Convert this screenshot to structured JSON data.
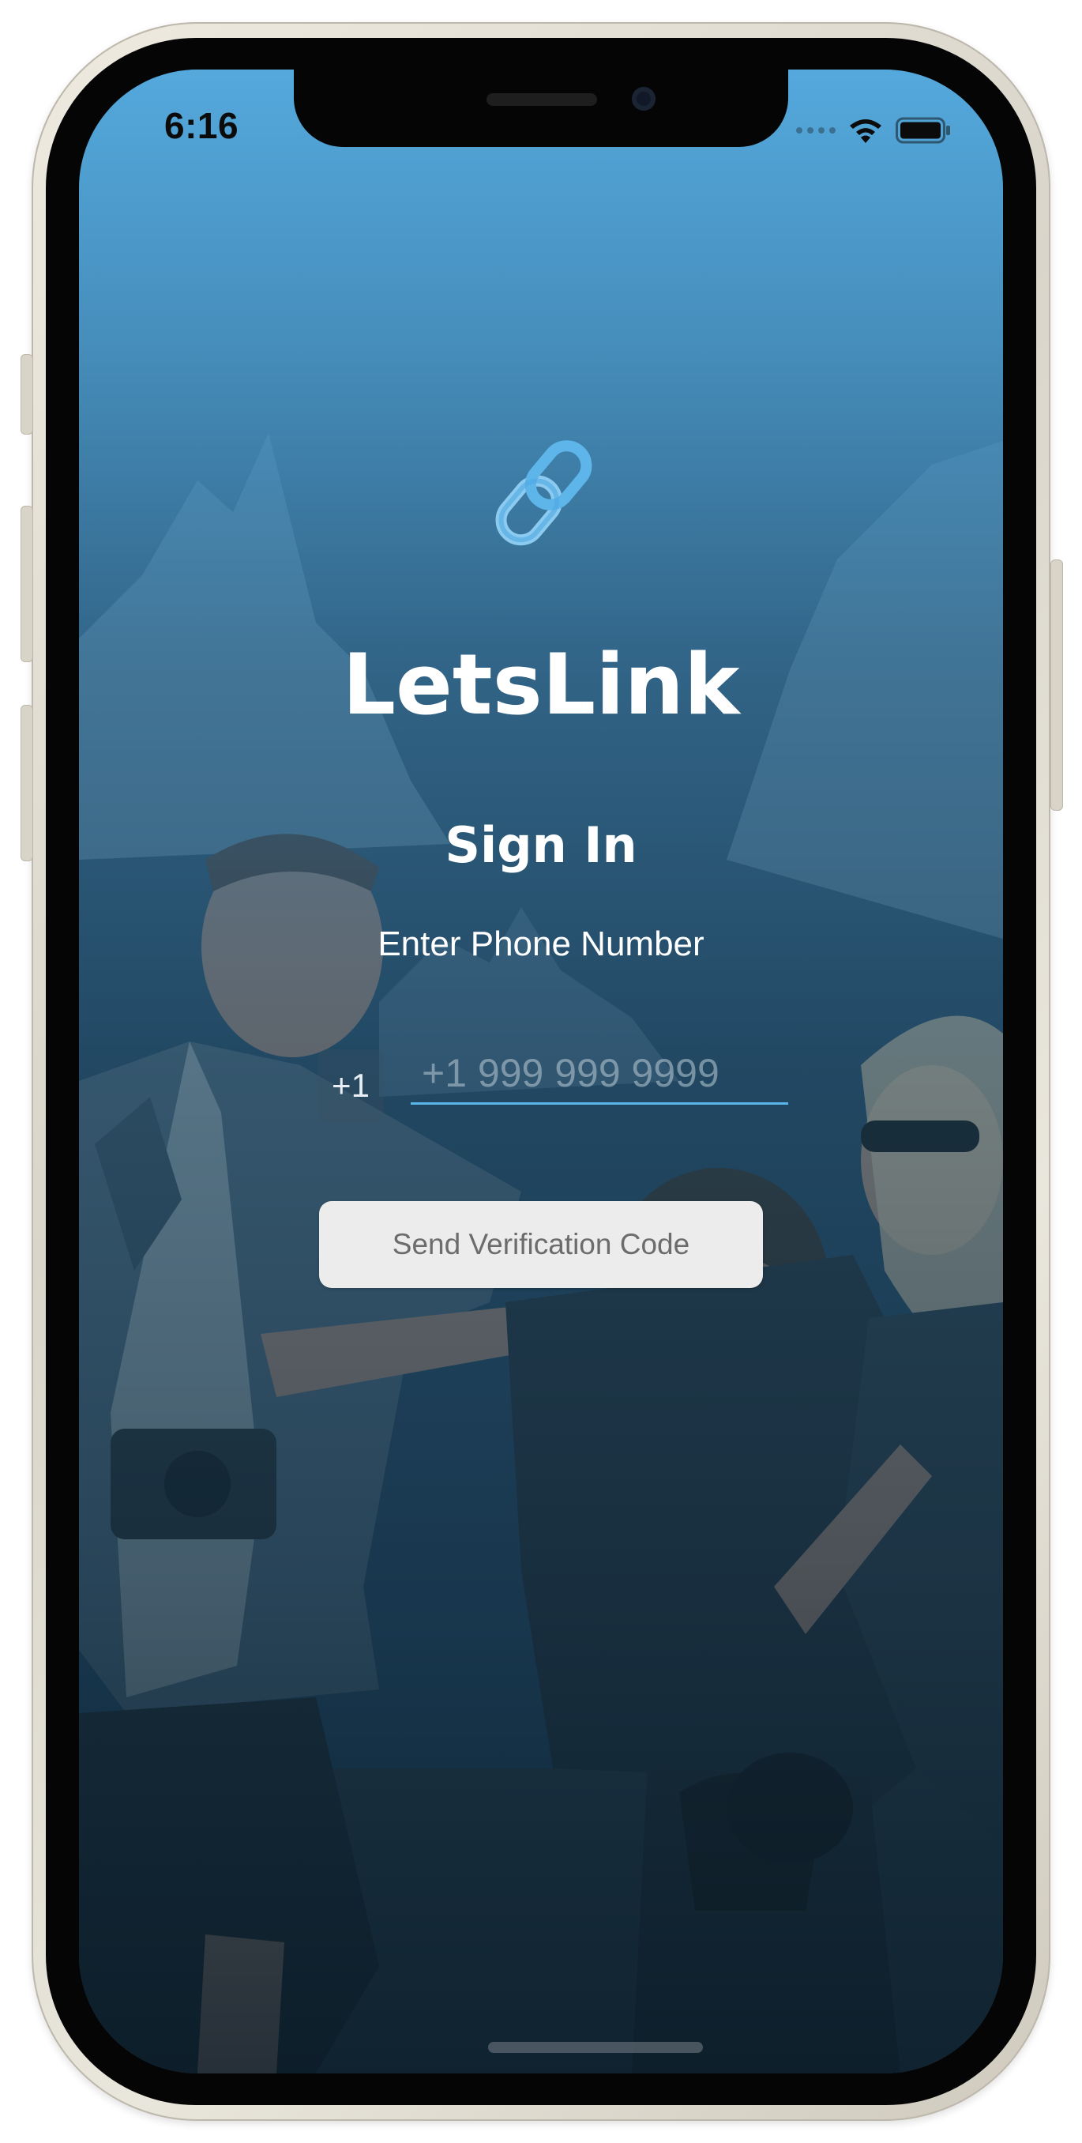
{
  "status_bar": {
    "time": "6:16"
  },
  "app": {
    "name": "LetsLink",
    "logo_icon": "chain-link-icon"
  },
  "sign_in": {
    "title": "Sign In",
    "phone_label": "Enter Phone Number",
    "country_code": "+1",
    "phone_placeholder": "+1 999 999 9999",
    "phone_value": "",
    "send_button_label": "Send Verification Code"
  },
  "colors": {
    "accent": "#5bb6ea",
    "gradient_top": "#56ace1",
    "button_bg": "#ececec",
    "button_text": "#6c6c6c"
  }
}
